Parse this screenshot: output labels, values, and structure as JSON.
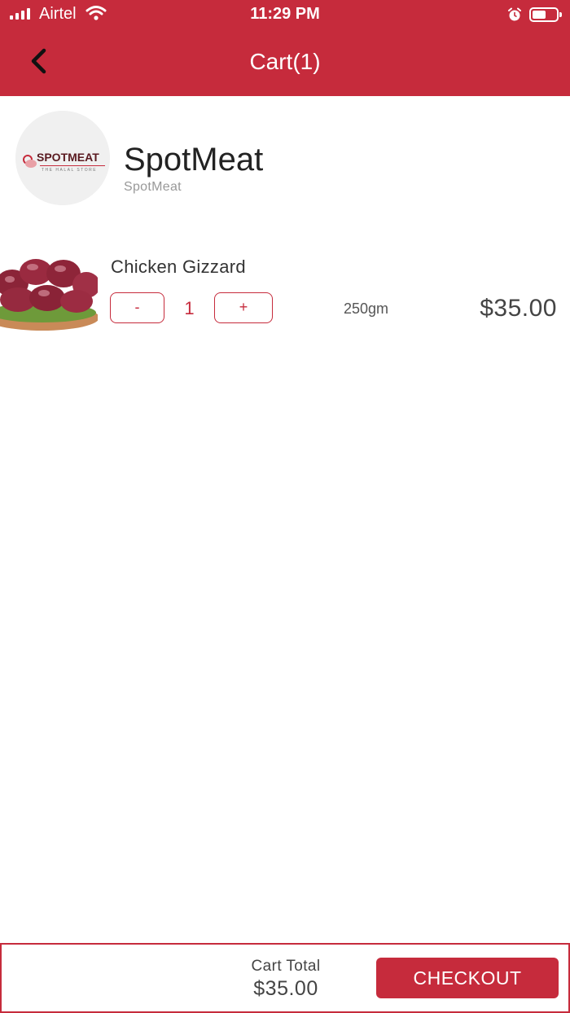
{
  "status_bar": {
    "carrier": "Airtel",
    "time": "11:29 PM",
    "signal_icon": "signal-bars-icon",
    "wifi_icon": "wifi-icon",
    "alarm_icon": "alarm-clock-icon",
    "battery_icon": "battery-icon"
  },
  "nav": {
    "title": "Cart(1)",
    "back_icon": "chevron-left-icon"
  },
  "store": {
    "name": "SpotMeat",
    "subtitle": "SpotMeat",
    "logo_brand": "SPOTMEAT",
    "logo_tagline": "THE HALAL STORE"
  },
  "cart": {
    "items": [
      {
        "name": "Chicken Gizzard",
        "quantity": "1",
        "minus_label": "-",
        "plus_label": "+",
        "weight": "250gm",
        "price": "$35.00"
      }
    ]
  },
  "footer": {
    "total_label": "Cart Total",
    "total_value": "$35.00",
    "checkout_label": "CHECKOUT"
  },
  "colors": {
    "brand": "#c62b3c",
    "background": "#ffffff"
  }
}
